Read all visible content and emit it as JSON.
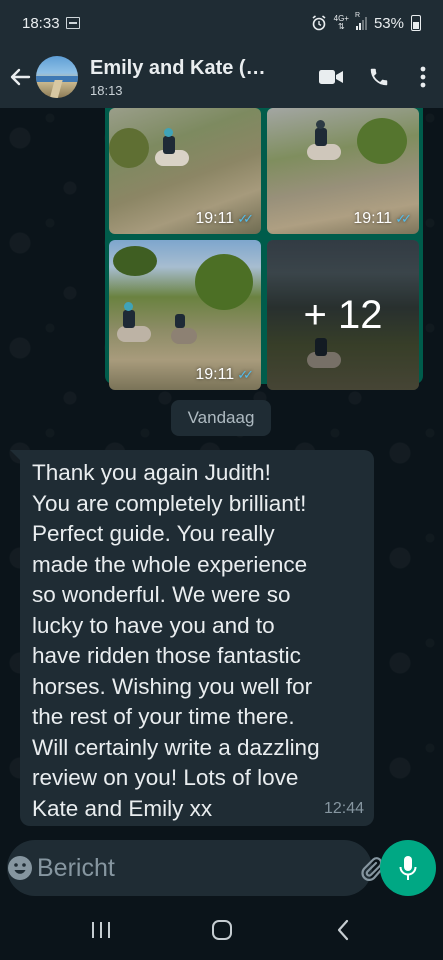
{
  "status_bar": {
    "time": "18:33",
    "network": "4G+",
    "sim_label": "R",
    "battery": "53%",
    "icons": [
      "gallery-icon",
      "alarm-icon",
      "signal-icon",
      "battery-icon"
    ]
  },
  "header": {
    "title": "Emily and Kate (…",
    "subtitle": "18:13",
    "icons": [
      "back-arrow-icon",
      "video-call-icon",
      "phone-icon",
      "more-vertical-icon"
    ]
  },
  "media_group": {
    "photos": [
      {
        "time": "19:11"
      },
      {
        "time": "19:11"
      },
      {
        "time": "19:11"
      },
      {
        "more": "+ 12"
      }
    ],
    "status_icon": "double-check-icon",
    "status_color": "#53bdeb"
  },
  "date_divider": "Vandaag",
  "message": {
    "text": "Thank you again Judith!\nYou are completely brilliant!\nPerfect guide.  You really\nmade the whole experience\nso wonderful.  We were so\nlucky to have you and to\nhave ridden those fantastic\nhorses.  Wishing you well for\nthe rest of your time there.\nWill certainly write a dazzling\nreview on you!  Lots of love\nKate and Emily xx",
    "time": "12:44"
  },
  "composer": {
    "placeholder": "Bericht",
    "icons": [
      "emoji-icon",
      "attach-icon",
      "camera-icon",
      "mic-icon"
    ]
  },
  "nav_bar": {
    "icons": [
      "recent-apps-icon",
      "home-icon",
      "back-icon"
    ]
  },
  "colors": {
    "background": "#0b141a",
    "bar": "#1f2c34",
    "outgoing_bubble": "#005c4b",
    "accent": "#00a884",
    "read_tick": "#53bdeb"
  }
}
